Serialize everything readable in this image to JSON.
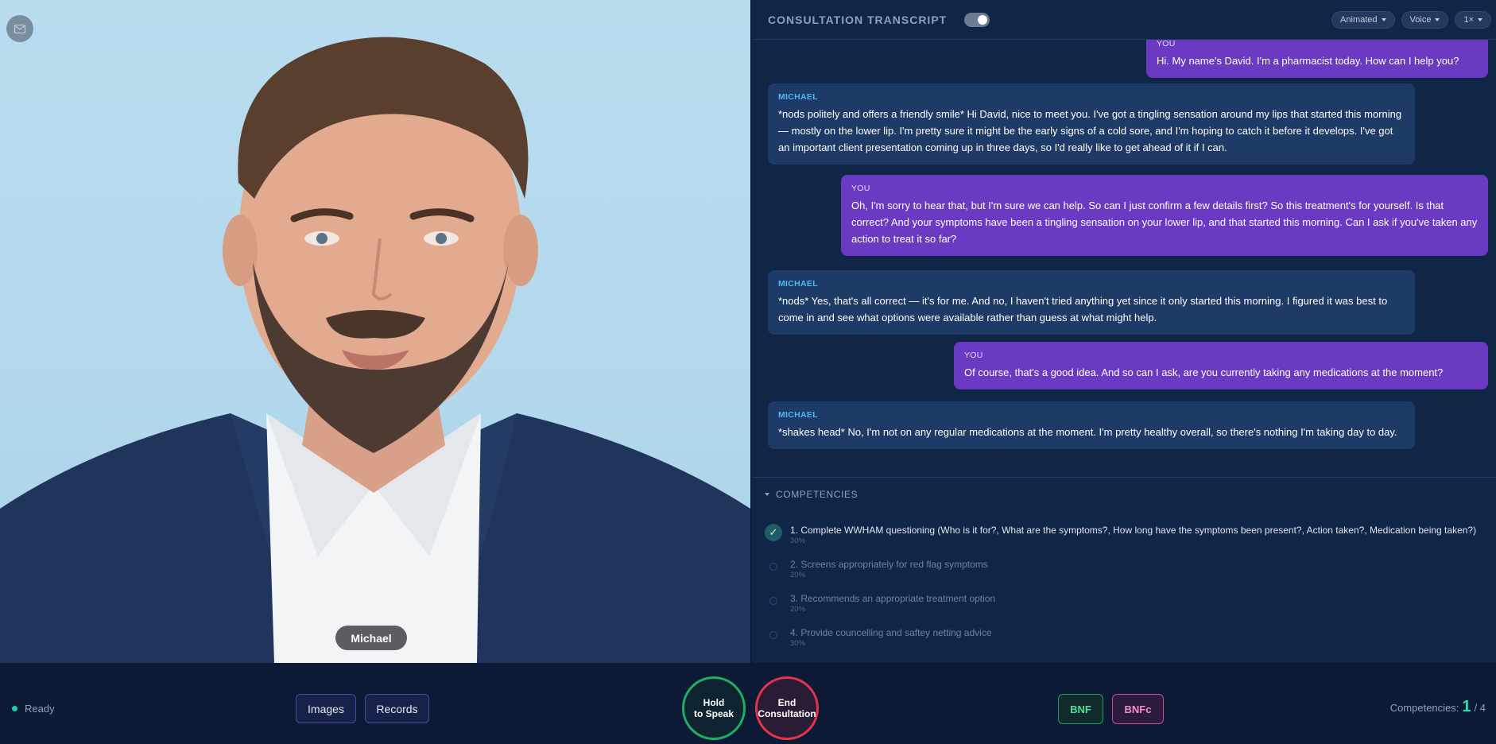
{
  "video": {
    "patient_name": "Michael",
    "mail_icon": "mail-icon"
  },
  "transcript": {
    "title": "CONSULTATION TRANSCRIPT",
    "toggle_on": true,
    "controls": {
      "animation": "Animated",
      "voice": "Voice",
      "speed": "1×"
    },
    "messages": [
      {
        "speaker": "YOU",
        "role": "you",
        "text": "Hi. My name's David. I'm a pharmacist today. How can I help you?"
      },
      {
        "speaker": "MICHAEL",
        "role": "michael",
        "text": "*nods politely and offers a friendly smile* Hi David, nice to meet you. I've got a tingling sensation around my lips that started this morning — mostly on the lower lip. I'm pretty sure it might be the early signs of a cold sore, and I'm hoping to catch it before it develops. I've got an important client presentation coming up in three days, so I'd really like to get ahead of it if I can."
      },
      {
        "speaker": "YOU",
        "role": "you",
        "text": "Oh, I'm sorry to hear that, but I'm sure we can help. So can I just confirm a few details first? So this treatment's for yourself. Is that correct? And your symptoms have been a tingling sensation on your lower lip, and that started this morning. Can I ask if you've taken any action to treat it so far?"
      },
      {
        "speaker": "MICHAEL",
        "role": "michael",
        "text": "*nods* Yes, that's all correct — it's for me. And no, I haven't tried anything yet since it only started this morning. I figured it was best to come in and see what options were available rather than guess at what might help."
      },
      {
        "speaker": "YOU",
        "role": "you",
        "text": "Of course, that's a good idea. And so can I ask, are you currently taking any medications at the moment?"
      },
      {
        "speaker": "MICHAEL",
        "role": "michael",
        "text": "*shakes head* No, I'm not on any regular medications at the moment. I'm pretty healthy overall, so there's nothing I'm taking day to day."
      }
    ]
  },
  "competencies": {
    "title": "COMPETENCIES",
    "items": [
      {
        "label": "1. Complete WWHAM questioning (Who is it for?, What are the symptoms?, How long have the symptoms been present?, Action taken?, Medication being taken?)",
        "weight": "30%",
        "done": true
      },
      {
        "label": "2. Screens appropriately for red flag symptoms",
        "weight": "20%",
        "done": false
      },
      {
        "label": "3. Recommends an appropriate treatment option",
        "weight": "20%",
        "done": false
      },
      {
        "label": "4. Provide councelling and saftey netting advice",
        "weight": "30%",
        "done": false
      }
    ]
  },
  "bottom": {
    "status": "Ready",
    "images_label": "Images",
    "records_label": "Records",
    "speak_label": "Hold to Speak",
    "end_label": "End Consultation",
    "bnf_label": "BNF",
    "bnfc_label": "BNFc",
    "competencies_label": "Competencies:",
    "competencies_done": "1",
    "competencies_total": "/ 4"
  },
  "colors": {
    "accent_you": "#6b3ac2",
    "accent_michael": "#1e3a66",
    "speak": "#1fae63",
    "end": "#e3344b",
    "bnf": "#45e39a",
    "bnfc": "#f58bd0"
  }
}
